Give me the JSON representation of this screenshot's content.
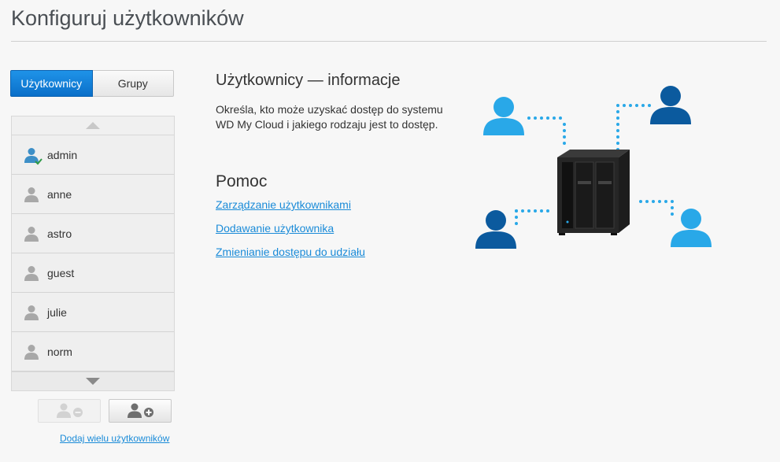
{
  "header": {
    "title": "Konfiguruj użytkowników"
  },
  "tabs": [
    {
      "label": "Użytkownicy",
      "active": true
    },
    {
      "label": "Grupy",
      "active": false
    }
  ],
  "users": [
    {
      "name": "admin",
      "is_admin": true
    },
    {
      "name": "anne"
    },
    {
      "name": "astro"
    },
    {
      "name": "guest"
    },
    {
      "name": "julie"
    },
    {
      "name": "norm"
    }
  ],
  "actions": {
    "remove_user_icon": "user-minus-icon",
    "add_user_icon": "user-plus-icon",
    "bulk_add_link": "Dodaj wielu użytkowników"
  },
  "info": {
    "title": "Użytkownicy — informacje",
    "description": "Określa, kto może uzyskać dostęp do systemu WD My Cloud i jakiego rodzaju jest to dostęp."
  },
  "help": {
    "title": "Pomoc",
    "links": [
      "Zarządzanie użytkownikami",
      "Dodawanie użytkownika",
      "Zmienianie dostępu do udziału"
    ]
  },
  "colors": {
    "accent_blue": "#0a6fc9",
    "link_blue": "#1a8bd8",
    "illustration_light": "#29a8e8",
    "illustration_dark": "#0b5a9e"
  }
}
